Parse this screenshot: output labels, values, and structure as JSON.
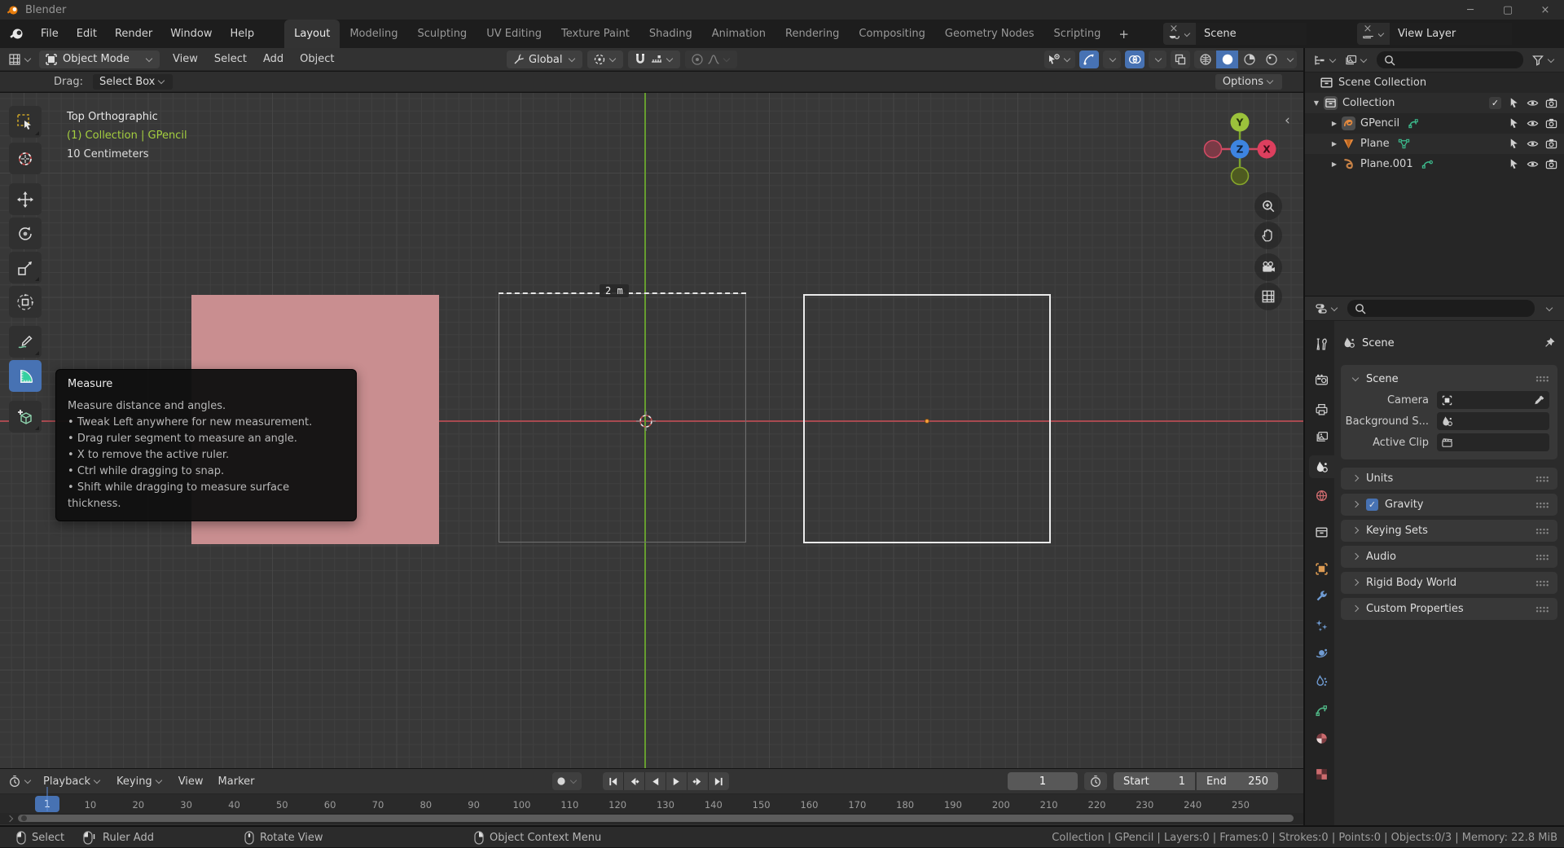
{
  "window": {
    "title": "Blender"
  },
  "topbar": {
    "menus": [
      "File",
      "Edit",
      "Render",
      "Window",
      "Help"
    ],
    "workspaces": [
      {
        "label": "Layout",
        "active": true
      },
      {
        "label": "Modeling"
      },
      {
        "label": "Sculpting"
      },
      {
        "label": "UV Editing"
      },
      {
        "label": "Texture Paint"
      },
      {
        "label": "Shading"
      },
      {
        "label": "Animation"
      },
      {
        "label": "Rendering"
      },
      {
        "label": "Compositing"
      },
      {
        "label": "Geometry Nodes"
      },
      {
        "label": "Scripting"
      }
    ],
    "new_workspace": "+",
    "scene": {
      "value": "Scene"
    },
    "view_layer": {
      "value": "View Layer"
    }
  },
  "viewport": {
    "header": {
      "mode": "Object Mode",
      "menus": [
        "View",
        "Select",
        "Add",
        "Object"
      ],
      "orientation": "Global"
    },
    "tool_settings": {
      "drag_label": "Drag:",
      "drag_value": "Select Box",
      "options": "Options"
    },
    "overlay": {
      "view": "Top Orthographic",
      "context": "(1) Collection | GPencil",
      "grid": "10 Centimeters"
    },
    "measure": "2 m",
    "gizmo": {
      "x": "X",
      "y": "Y",
      "z": "Z"
    }
  },
  "tooltip": {
    "title": "Measure",
    "desc": "Measure distance and angles.",
    "bullets": [
      "Tweak Left anywhere for new measurement.",
      "Drag ruler segment to measure an angle.",
      "X to remove the active ruler.",
      "Ctrl while dragging to snap.",
      "Shift while dragging to measure surface thickness."
    ]
  },
  "outliner": {
    "rows": [
      {
        "label": "Scene Collection"
      },
      {
        "label": "Collection"
      },
      {
        "label": "GPencil"
      },
      {
        "label": "Plane"
      },
      {
        "label": "Plane.001"
      }
    ]
  },
  "properties": {
    "breadcrumb": "Scene",
    "scene_panel": {
      "title": "Scene",
      "fields": [
        {
          "label": "Camera"
        },
        {
          "label": "Background S..."
        },
        {
          "label": "Active Clip"
        }
      ]
    },
    "sections": [
      {
        "label": "Units"
      },
      {
        "label": "Gravity",
        "checked": true
      },
      {
        "label": "Keying Sets"
      },
      {
        "label": "Audio"
      },
      {
        "label": "Rigid Body World"
      },
      {
        "label": "Custom Properties"
      }
    ]
  },
  "timeline": {
    "menus": [
      {
        "label": "Playback"
      },
      {
        "label": "Keying"
      },
      {
        "label": "View"
      },
      {
        "label": "Marker"
      }
    ],
    "current_frame": "1",
    "start_label": "Start",
    "start_value": "1",
    "end_label": "End",
    "end_value": "250",
    "ruler_step": 10,
    "ruler_end": 250
  },
  "statusbar": {
    "hints": [
      {
        "label": "Select"
      },
      {
        "label": "Ruler Add"
      },
      {
        "label": "Rotate View"
      },
      {
        "label": "Object Context Menu"
      }
    ],
    "stats": "Collection | GPencil | Layers:0 | Frames:0 | Strokes:0 | Points:0 | Objects:0/3 | Memory: 22.8 MiB"
  },
  "colors": {
    "accent": "#4772b3",
    "axis_x": "#a84a50",
    "axis_y": "#669d2f",
    "selected_fill": "#c98e90"
  }
}
